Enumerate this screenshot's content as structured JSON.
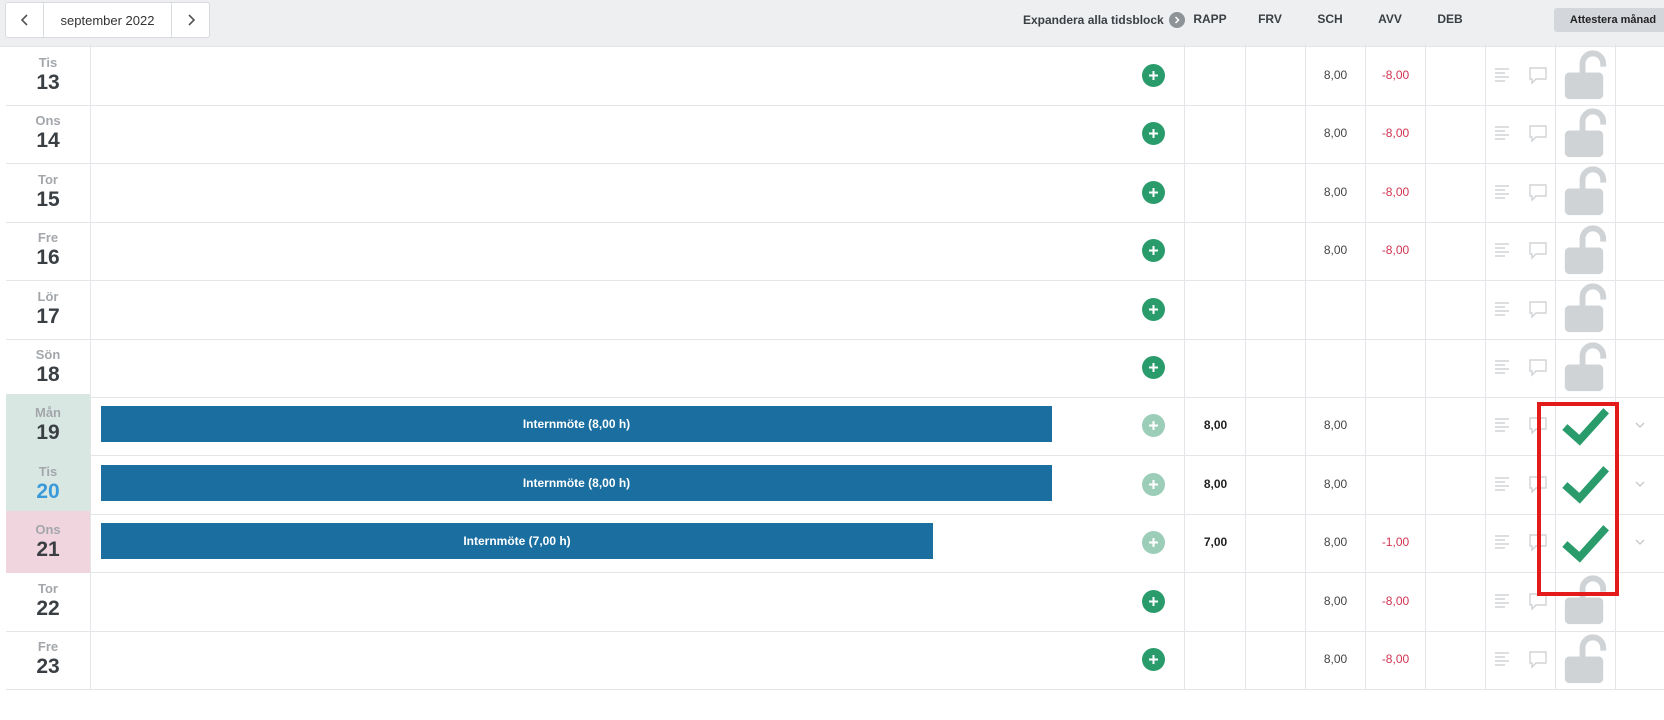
{
  "header": {
    "month": "september 2022",
    "expand_all": "Expandera alla tidsblock",
    "columns": {
      "rapp": "RAPP",
      "frv": "FRV",
      "sch": "SCH",
      "avv": "AVV",
      "deb": "DEB"
    },
    "attest_label": "Attestera månad"
  },
  "colors": {
    "time_block": "#1a6ea0",
    "add_button": "#2a9b6b",
    "negative": "#d03450",
    "approved": "#2a9b6b",
    "highlight": "#e41b1b"
  },
  "rows": [
    {
      "day": "Tis",
      "date": "13",
      "block": "",
      "rapp": "",
      "frv": "",
      "sch": "8,00",
      "avv": "-8,00",
      "deb": "",
      "status": "unlocked"
    },
    {
      "day": "Ons",
      "date": "14",
      "block": "",
      "rapp": "",
      "frv": "",
      "sch": "8,00",
      "avv": "-8,00",
      "deb": "",
      "status": "unlocked"
    },
    {
      "day": "Tor",
      "date": "15",
      "block": "",
      "rapp": "",
      "frv": "",
      "sch": "8,00",
      "avv": "-8,00",
      "deb": "",
      "status": "unlocked"
    },
    {
      "day": "Fre",
      "date": "16",
      "block": "",
      "rapp": "",
      "frv": "",
      "sch": "8,00",
      "avv": "-8,00",
      "deb": "",
      "status": "unlocked"
    },
    {
      "day": "Lör",
      "date": "17",
      "block": "",
      "rapp": "",
      "frv": "",
      "sch": "",
      "avv": "",
      "deb": "",
      "status": "unlocked"
    },
    {
      "day": "Sön",
      "date": "18",
      "block": "",
      "rapp": "",
      "frv": "",
      "sch": "",
      "avv": "",
      "deb": "",
      "status": "unlocked"
    },
    {
      "day": "Mån",
      "date": "19",
      "block": "Internmöte (8,00 h)",
      "block_fraction": 1.0,
      "rapp": "8,00",
      "frv": "",
      "sch": "8,00",
      "avv": "",
      "deb": "",
      "status": "approved"
    },
    {
      "day": "Tis",
      "date": "20",
      "block": "Internmöte (8,00 h)",
      "block_fraction": 1.0,
      "rapp": "8,00",
      "frv": "",
      "sch": "8,00",
      "avv": "",
      "deb": "",
      "status": "approved"
    },
    {
      "day": "Ons",
      "date": "21",
      "block": "Internmöte (7,00 h)",
      "block_fraction": 0.875,
      "rapp": "7,00",
      "frv": "",
      "sch": "8,00",
      "avv": "-1,00",
      "deb": "",
      "status": "approved"
    },
    {
      "day": "Tor",
      "date": "22",
      "block": "",
      "rapp": "",
      "frv": "",
      "sch": "8,00",
      "avv": "-8,00",
      "deb": "",
      "status": "unlocked"
    },
    {
      "day": "Fre",
      "date": "23",
      "block": "",
      "rapp": "",
      "frv": "",
      "sch": "8,00",
      "avv": "-8,00",
      "deb": "",
      "status": "unlocked"
    }
  ]
}
